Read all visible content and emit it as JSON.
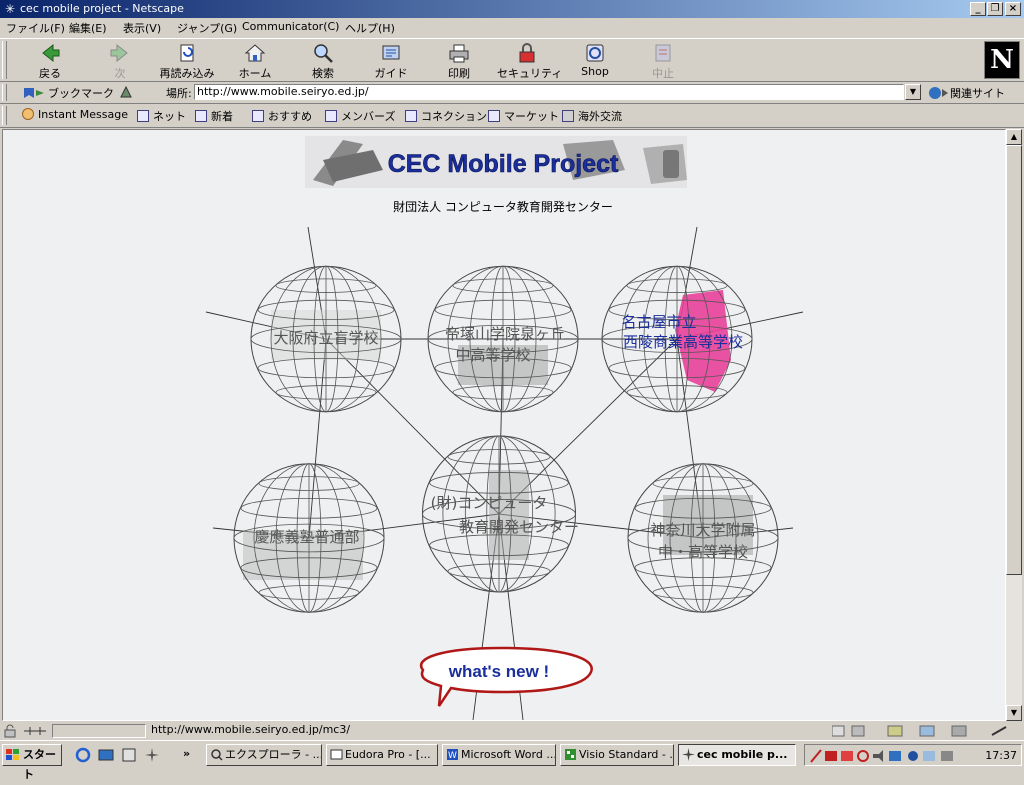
{
  "window": {
    "title": "cec mobile project - Netscape"
  },
  "menu": [
    "ファイル(F)",
    "編集(E)",
    "表示(V)",
    "ジャンプ(G)",
    "Communicator(C)",
    "ヘルプ(H)"
  ],
  "toolbar": {
    "back": "戻る",
    "forward": "次",
    "reload": "再読み込み",
    "home": "ホーム",
    "search": "検索",
    "guide": "ガイド",
    "print": "印刷",
    "security": "セキュリティ",
    "shop": "Shop",
    "stop": "中止"
  },
  "location": {
    "bookmarks": "ブックマーク",
    "label": "場所:",
    "url": "http://www.mobile.seiryo.ed.jp/",
    "related": "関連サイト"
  },
  "personal_toolbar": [
    "Instant Message",
    "ネット",
    "新着",
    "おすすめ",
    "メンバーズ",
    "コネクション",
    "マーケット",
    "海外交流"
  ],
  "page": {
    "banner_title": "CEC  Mobile  Project",
    "subtitle": "財団法人  コンピュータ教育開発センター",
    "globes": {
      "osaka": [
        "大阪府立盲学校"
      ],
      "tezukayama": [
        "帝塚山学院泉ヶ丘",
        "中高等学校"
      ],
      "nagoya": [
        "名古屋市立",
        "西陵商業高等学校"
      ],
      "keio": [
        "慶應義塾普通部"
      ],
      "cec": [
        "(財)コンピュータ",
        "教育開発センター"
      ],
      "kanagawa": [
        "神奈川大学附属",
        "中・高等学校"
      ]
    },
    "whats_new": "what's new !"
  },
  "status": {
    "url": "http://www.mobile.seiryo.ed.jp/mc3/"
  },
  "taskbar": {
    "start": "スタート",
    "tasks": [
      "エクスプローラ - ...",
      "Eudora Pro - [...",
      "Microsoft Word ...",
      "Visio Standard - ...",
      "cec mobile p..."
    ],
    "clock": "17:37"
  },
  "colors": {
    "accent_blue": "#1a2e9c",
    "titlebar": "#0a246a",
    "whats_new_red": "#b01818",
    "pink": "#e8409a"
  }
}
